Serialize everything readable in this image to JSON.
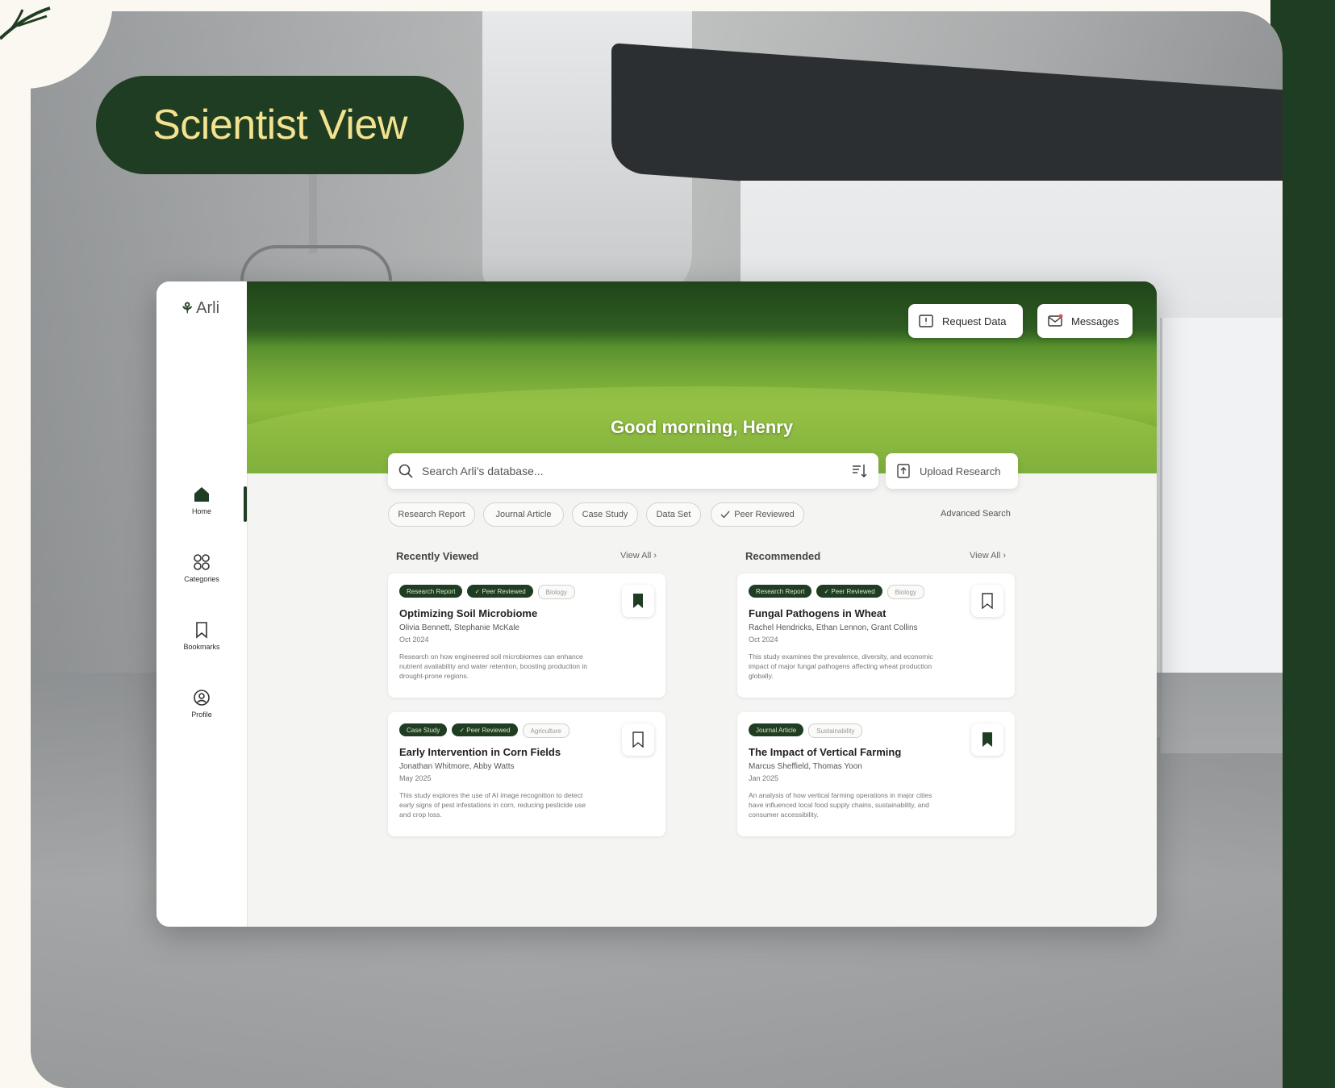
{
  "badge": {
    "label": "Scientist View"
  },
  "app": {
    "logo": "Arli",
    "greeting": "Good morning, Henry",
    "top_buttons": {
      "request": "Request Data",
      "messages": "Messages"
    },
    "nav": [
      {
        "label": "Home",
        "icon": "home-icon",
        "active": true
      },
      {
        "label": "Categories",
        "icon": "grid-icon",
        "active": false
      },
      {
        "label": "Bookmarks",
        "icon": "bookmark-icon",
        "active": false
      },
      {
        "label": "Profile",
        "icon": "profile-icon",
        "active": false
      }
    ],
    "search": {
      "placeholder": "Search Arli's database...",
      "upload_label": "Upload Research"
    },
    "filters": [
      "Research Report",
      "Journal Article",
      "Case Study",
      "Data Set",
      "Peer Reviewed"
    ],
    "advanced_search": "Advanced Search",
    "sections": {
      "recent": {
        "title": "Recently Viewed",
        "view_all": "View All"
      },
      "recommended": {
        "title": "Recommended",
        "view_all": "View All"
      }
    },
    "cards": [
      {
        "tags": [
          "Research Report",
          "✓ Peer Reviewed",
          "Biology"
        ],
        "title": "Optimizing Soil Microbiome",
        "authors": "Olivia Bennett, Stephanie McKale",
        "date": "Oct 2024",
        "desc": "Research on how engineered soil microbiomes can enhance nutrient availability and water retention, boosting production in drought-prone regions.",
        "bookmarked": true
      },
      {
        "tags": [
          "Research Report",
          "✓ Peer Reviewed",
          "Biology"
        ],
        "title": "Fungal Pathogens in Wheat",
        "authors": "Rachel Hendricks, Ethan Lennon, Grant Collins",
        "date": "Oct 2024",
        "desc": "This study examines the prevalence, diversity, and economic impact of major fungal pathogens affecting wheat production globally.",
        "bookmarked": false
      },
      {
        "tags": [
          "Case Study",
          "✓ Peer Reviewed",
          "Agriculture"
        ],
        "title": "Early Intervention in Corn Fields",
        "authors": "Jonathan Whitmore, Abby Watts",
        "date": "May 2025",
        "desc": "This study explores the use of AI image recognition to detect early signs of pest infestations in corn, reducing pesticide use and crop loss.",
        "bookmarked": false
      },
      {
        "tags": [
          "Journal Article",
          "Sustainability"
        ],
        "title": "The Impact of Vertical Farming",
        "authors": "Marcus Sheffield, Thomas Yoon",
        "date": "Jan 2025",
        "desc": "An analysis of how vertical farming operations in major cities have influenced local food supply chains, sustainability, and consumer accessibility.",
        "bookmarked": true
      }
    ]
  },
  "colors": {
    "brand_dark": "#1f3d22",
    "badge_text": "#f3e28f",
    "background": "#fbf8f1"
  }
}
